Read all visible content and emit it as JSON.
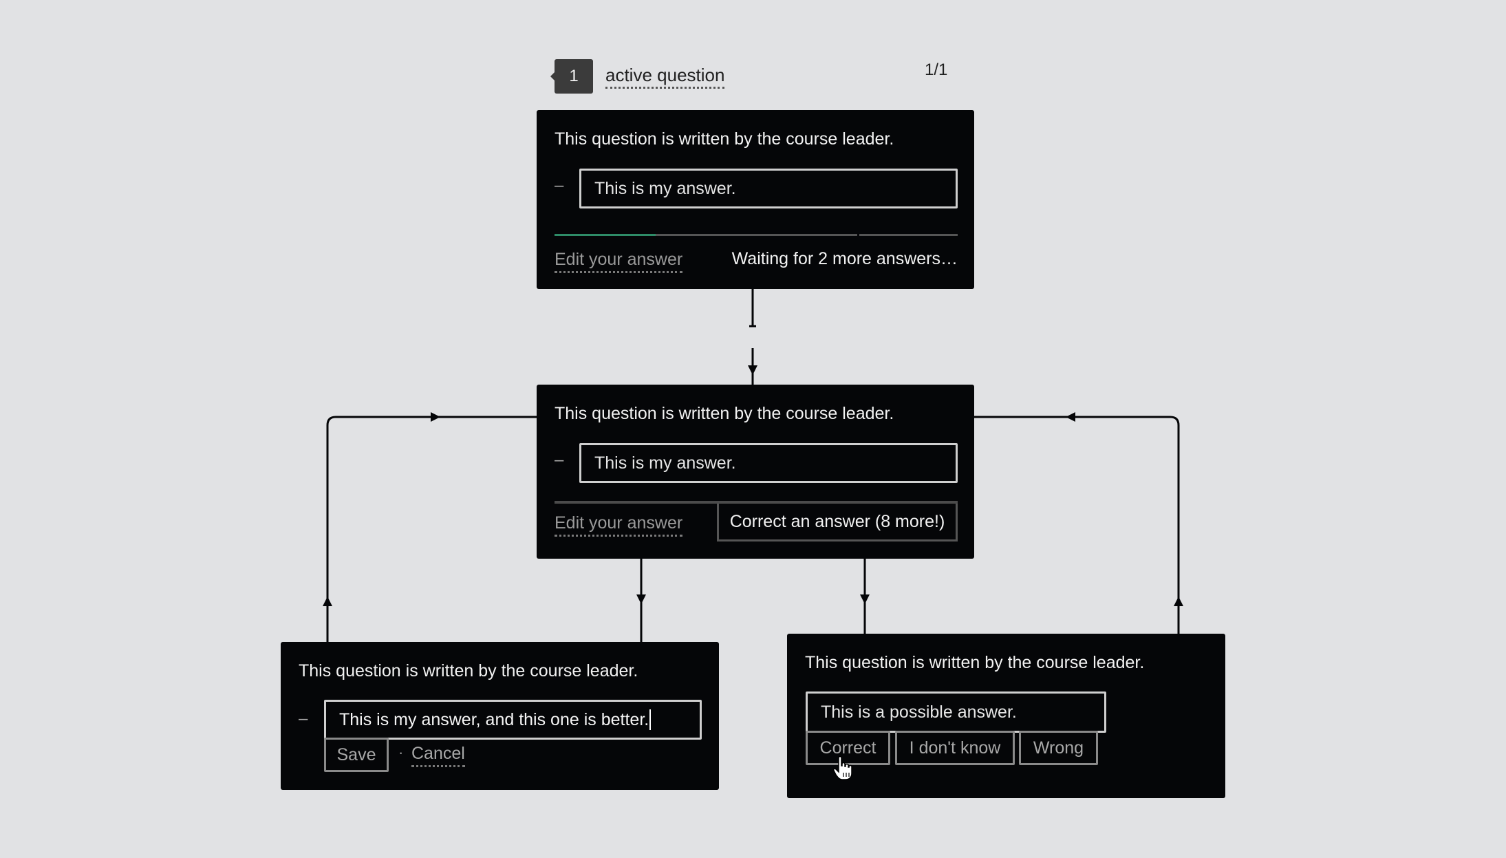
{
  "header": {
    "badge_count": "1",
    "label": "active question",
    "pager": "1/1"
  },
  "colors": {
    "background": "#e1e2e4",
    "card": "#050608",
    "progress_done": "#2e8b67",
    "progress_track": "#555555"
  },
  "cards": {
    "waiting": {
      "question": "This question is written by the course leader.",
      "bullet": "–",
      "answer": "This is my answer.",
      "progress": {
        "completed_fraction": 0.25,
        "segment_break_fraction": 0.75
      },
      "edit_link": "Edit your answer",
      "status": "Waiting for 2 more answers…"
    },
    "ready": {
      "question": "This question is written by the course leader.",
      "bullet": "–",
      "answer": "This is my answer.",
      "edit_link": "Edit your answer",
      "correct_button": "Correct an answer (8 more!)"
    },
    "editing": {
      "question": "This question is written by the course leader.",
      "bullet": "–",
      "answer_value": "This is my answer, and this one is better.",
      "save_button": "Save",
      "separator": "·",
      "cancel_link": "Cancel"
    },
    "grading": {
      "question": "This question is written by the course leader.",
      "possible_answer": "This is a possible answer.",
      "buttons": [
        "Correct",
        "I don't know",
        "Wrong"
      ]
    }
  },
  "flow": {
    "edges": [
      {
        "from": "waiting",
        "to": "ready",
        "style": "dashed-gap"
      },
      {
        "from": "ready",
        "to": "editing"
      },
      {
        "from": "ready",
        "to": "grading"
      },
      {
        "from": "editing",
        "to": "ready"
      },
      {
        "from": "grading",
        "to": "ready"
      }
    ]
  }
}
